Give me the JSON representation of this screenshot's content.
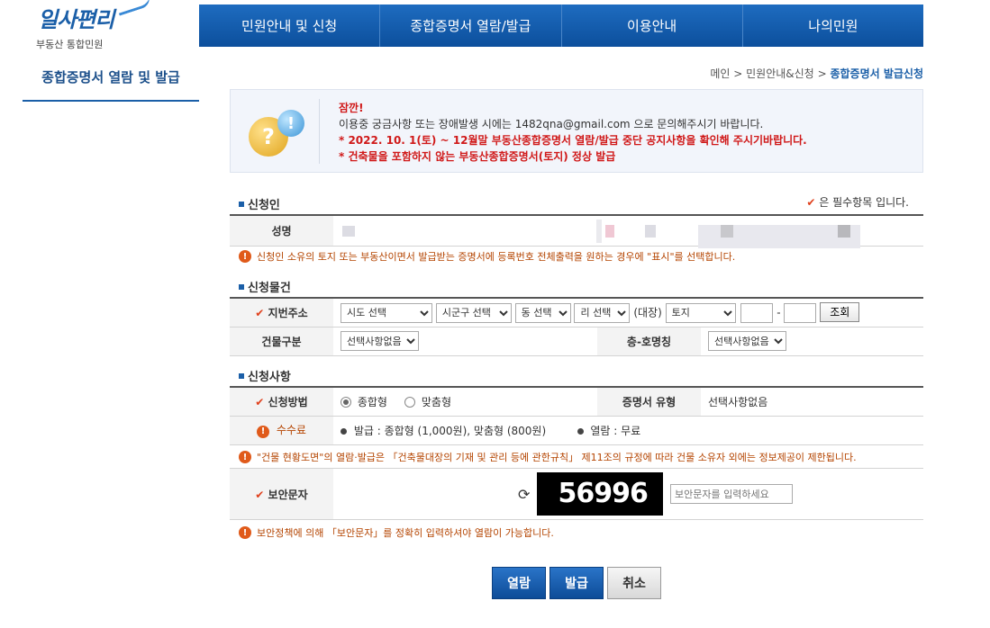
{
  "logo": {
    "brand": "일사편리",
    "sub": "부동산 통합민원"
  },
  "nav": [
    "민원안내 및 신청",
    "종합증명서 열람/발급",
    "이용안내",
    "나의민원"
  ],
  "sidebar": {
    "title": "종합증명서 열람 및 발급"
  },
  "breadcrumb": {
    "home": "메인",
    "sep1": ">",
    "mid": "민원안내&신청",
    "sep2": ">",
    "current": "종합증명서 발급신청"
  },
  "notice": {
    "title": "잠깐!",
    "line1": "이용중 궁금사항 또는 장애발생 시에는 1482qna@gmail.com 으로 문의해주시기 바랍니다.",
    "line2": "* 2022. 10. 1(토) ~ 12월말 부동산종합증명서 열람/발급 중단 공지사항을 확인해 주시기바랍니다.",
    "line3": "* 건축물을 포함하지 않는 부동산종합증명서(토지) 정상 발급"
  },
  "applicant": {
    "header": "신청인",
    "required_note": "은 필수항목 입니다.",
    "name_label": "성명",
    "hint": "신청인 소유의 토지 또는 부동산이면서 발급받는 증명서에 등록번호 전체출력을 원하는 경우에 \"표시\"를 선택합니다."
  },
  "property": {
    "header": "신청물건",
    "address_label": "지번주소",
    "sido": "시도 선택",
    "sigungu": "시군구 선택",
    "dong": "동 선택",
    "ri": "리 선택",
    "daejang_label": "(대장)",
    "land_type": "토지",
    "dash": "-",
    "lookup_button": "조회",
    "building_label": "건물구분",
    "building_value": "선택사항없음",
    "floor_label": "층-호명칭",
    "floor_value": "선택사항없음"
  },
  "request": {
    "header": "신청사항",
    "method_label": "신청방법",
    "opt_comprehensive": "종합형",
    "opt_custom": "맞춤형",
    "cert_type_label": "증명서 유형",
    "cert_type_value": "선택사항없음",
    "fee_label": "수수료",
    "fee_issue": "발급 : 종합형 (1,000원), 맞춤형 (800원)",
    "fee_view": "열람 : 무료",
    "hint": "\"건물 현황도면\"의 열람·발급은 「건축물대장의 기재 및 관리 등에 관한규칙」 제11조의 규정에 따라 건물 소유자 외에는 정보제공이 제한됩니다.",
    "captcha_label": "보안문자",
    "captcha_value": "56996",
    "captcha_placeholder": "보안문자를 입력하세요",
    "captcha_hint": "보안정책에 의해 「보안문자」를 정확히 입력하셔야 열람이 가능합니다."
  },
  "buttons": {
    "view": "열람",
    "issue": "발급",
    "cancel": "취소"
  },
  "colors": {
    "primary": "#1b5fa8",
    "alert": "#d01919",
    "hint": "#b44400"
  }
}
